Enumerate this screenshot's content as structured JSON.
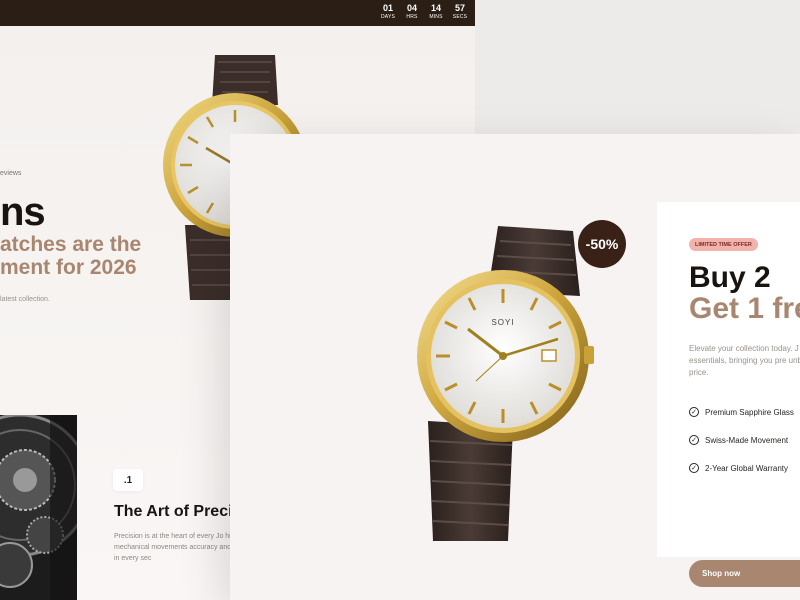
{
  "countdown": [
    {
      "value": "01",
      "label": "DAYS"
    },
    {
      "value": "04",
      "label": "HRS"
    },
    {
      "value": "14",
      "label": "MINS"
    },
    {
      "value": "57",
      "label": "SECS"
    }
  ],
  "back_hero": {
    "reviews": "eviews",
    "title": "ns",
    "subtitle": "atches are the ment for 2026",
    "description": "latest collection."
  },
  "precision": {
    "badge": ".1",
    "title": "The Art of Preci",
    "text": "Precision is at the heart of every Jo high-grade mechanical movements accuracy and reliability in every sec"
  },
  "front": {
    "discount": "-50%",
    "watch_brand": "SOYI",
    "offer": {
      "badge": "LIMITED TIME OFFER",
      "title": "Buy 2",
      "subtitle": "Get 1 fre",
      "description": "Elevate your collection today. J the essentials, bringing you pre unbeatable price.",
      "features": [
        "Premium Sapphire Glass",
        "Swiss-Made Movement",
        "2-Year Global Warranty"
      ],
      "cta": "Shop now"
    }
  },
  "colors": {
    "accent": "#a88670",
    "dark": "#2b1e15",
    "discount_bg": "#3a2117",
    "badge_bg": "#f2b3ad"
  }
}
